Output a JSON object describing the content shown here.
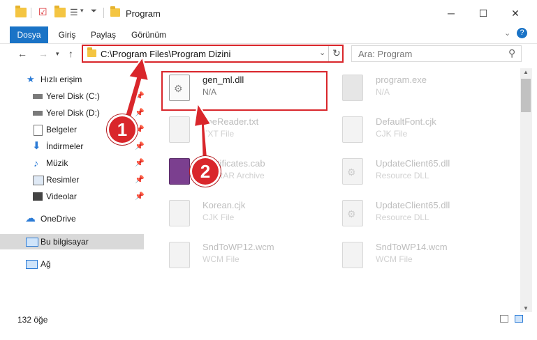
{
  "window": {
    "title": "Program"
  },
  "ribbon": {
    "tabs": [
      "Dosya",
      "Giriş",
      "Paylaş",
      "Görünüm"
    ]
  },
  "address": {
    "path": "C:\\Program Files\\Program Dizini"
  },
  "search": {
    "placeholder": "Ara: Program"
  },
  "sidebar": {
    "items": [
      {
        "label": "Hızlı erişim",
        "pinned": false
      },
      {
        "label": "Yerel Disk (C:)",
        "pinned": true
      },
      {
        "label": "Yerel Disk (D:)",
        "pinned": true
      },
      {
        "label": "Belgeler",
        "pinned": true
      },
      {
        "label": "İndirmeler",
        "pinned": true
      },
      {
        "label": "Müzik",
        "pinned": true
      },
      {
        "label": "Resimler",
        "pinned": true
      },
      {
        "label": "Videolar",
        "pinned": true
      },
      {
        "label": "OneDrive",
        "pinned": false
      },
      {
        "label": "Bu bilgisayar",
        "pinned": false,
        "selected": true
      },
      {
        "label": "Ağ",
        "pinned": false
      }
    ]
  },
  "files": [
    {
      "name": "gen_ml.dll",
      "type": "N/A",
      "highlighted": true
    },
    {
      "name": "program.exe",
      "type": "N/A"
    },
    {
      "name": "fineReader.txt",
      "type": "TXT File"
    },
    {
      "name": "DefaultFont.cjk",
      "type": "CJK File"
    },
    {
      "name": "Certificates.cab",
      "type": "WinRAR Archive"
    },
    {
      "name": "UpdateClient65.dll",
      "type": "Resource DLL"
    },
    {
      "name": "Korean.cjk",
      "type": "CJK File"
    },
    {
      "name": "UpdateClient65.dll",
      "type": "Resource DLL"
    },
    {
      "name": "SndToWP12.wcm",
      "type": "WCM File"
    },
    {
      "name": "SndToWP14.wcm",
      "type": "WCM File"
    }
  ],
  "status": {
    "count": "132 öğe"
  },
  "callouts": [
    "1",
    "2"
  ],
  "colors": {
    "accent": "#1a73c6",
    "highlight": "#d9262b"
  }
}
